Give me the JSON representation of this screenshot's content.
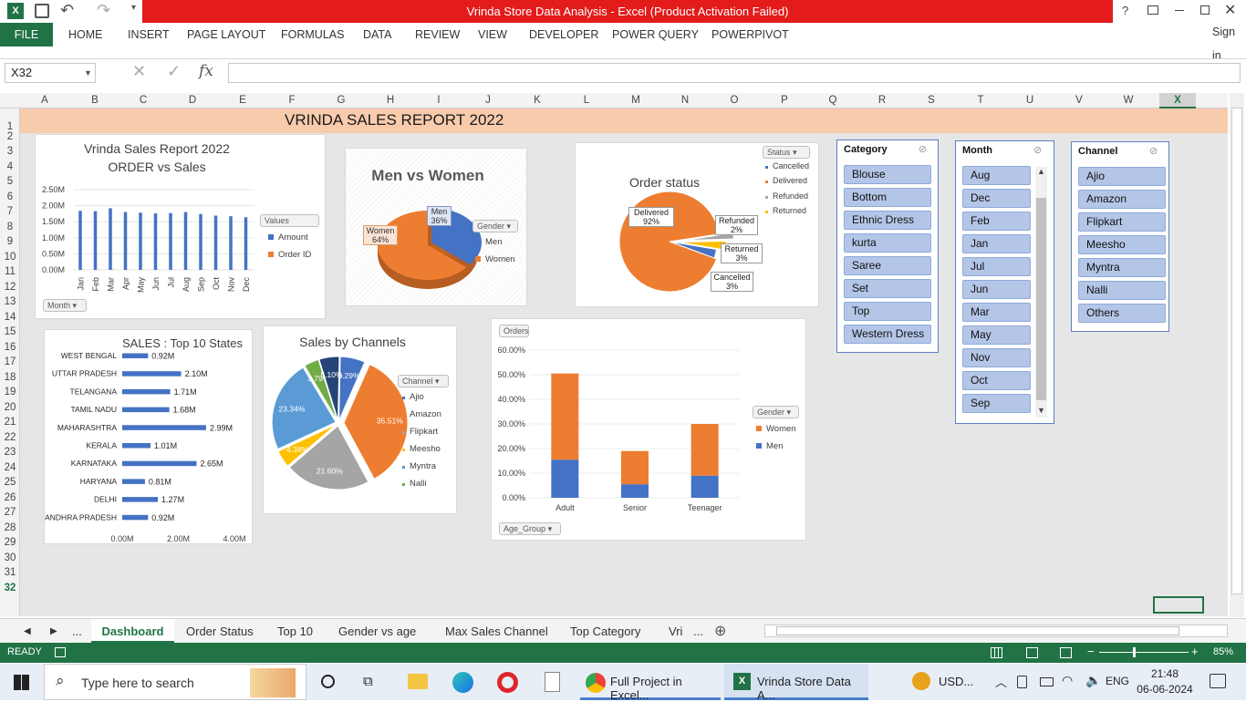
{
  "window": {
    "title": "Vrinda Store Data Analysis -  Excel (Product Activation Failed)",
    "help": "?",
    "signin": "Sign in"
  },
  "ribbon": {
    "file": "FILE",
    "tabs": [
      "HOME",
      "INSERT",
      "PAGE LAYOUT",
      "FORMULAS",
      "DATA",
      "REVIEW",
      "VIEW",
      "DEVELOPER",
      "POWER QUERY",
      "POWERPIVOT"
    ]
  },
  "formula_bar": {
    "name_box": "X32",
    "formula": ""
  },
  "columns": [
    "A",
    "B",
    "C",
    "D",
    "E",
    "F",
    "G",
    "H",
    "I",
    "J",
    "K",
    "L",
    "M",
    "N",
    "O",
    "P",
    "Q",
    "R",
    "S",
    "T",
    "U",
    "V",
    "W",
    "X"
  ],
  "rows": [
    "1",
    "2",
    "3",
    "4",
    "5",
    "6",
    "7",
    "8",
    "9",
    "10",
    "11",
    "12",
    "13",
    "14",
    "15",
    "16",
    "17",
    "18",
    "19",
    "20",
    "21",
    "22",
    "23",
    "24",
    "25",
    "26",
    "27",
    "28",
    "29",
    "30",
    "31",
    "32"
  ],
  "banner": "VRINDA SALES REPORT 2022",
  "chart_orders_sales": {
    "chart_data": {
      "type": "bar",
      "title": "Vrinda Sales Report 2022\nORDER vs Sales",
      "categories": [
        "Jan",
        "Feb",
        "Mar",
        "Apr",
        "May",
        "Jun",
        "Jul",
        "Aug",
        "Sep",
        "Oct",
        "Nov",
        "Dec"
      ],
      "series": [
        {
          "name": "Amount",
          "values": [
            1.84,
            1.83,
            1.92,
            1.8,
            1.78,
            1.76,
            1.77,
            1.8,
            1.74,
            1.69,
            1.67,
            1.64
          ]
        },
        {
          "name": "Order ID",
          "values": [
            0.0027,
            0.0026,
            0.0028,
            0.0026,
            0.0026,
            0.0025,
            0.0025,
            0.0026,
            0.0025,
            0.0024,
            0.0024,
            0.0023
          ]
        }
      ],
      "ylim": [
        0,
        2.5
      ],
      "yticks": [
        "2.50M",
        "2.00M",
        "1.50M",
        "1.00M",
        "0.50M",
        "0.00M"
      ]
    },
    "title1": "Vrinda Sales Report 2022",
    "title2": "ORDER vs Sales",
    "values_chip": "Values",
    "month_chip": "Month"
  },
  "chart_gender": {
    "chart_data": {
      "type": "pie",
      "title": "Men vs Women",
      "labels": [
        "Men",
        "Women"
      ],
      "values": [
        36,
        64
      ]
    },
    "title": "Men vs Women",
    "chip": "Gender",
    "men_label": "Men\n36%",
    "women_label": "Women\n64%"
  },
  "chart_status": {
    "chart_data": {
      "type": "pie",
      "title": "Order status",
      "labels": [
        "Cancelled",
        "Delivered",
        "Refunded",
        "Returned"
      ],
      "values": [
        3,
        92,
        2,
        3
      ]
    },
    "title": "Order status",
    "chip": "Status",
    "lbl_delivered": "Delivered\n92%",
    "lbl_refunded": "Refunded\n2%",
    "lbl_returned": "Returned\n3%",
    "lbl_cancelled": "Cancelled\n3%"
  },
  "chart_states": {
    "chart_data": {
      "type": "bar",
      "title": "SALES : Top 10 States",
      "categories": [
        "WEST BENGAL",
        "UTTAR PRADESH",
        "TELANGANA",
        "TAMIL NADU",
        "MAHARASHTRA",
        "KERALA",
        "KARNATAKA",
        "HARYANA",
        "DELHI",
        "ANDHRA PRADESH"
      ],
      "values": [
        0.92,
        2.1,
        1.71,
        1.68,
        2.99,
        1.01,
        2.65,
        0.81,
        1.27,
        0.92
      ],
      "labels": [
        "0.92M",
        "2.10M",
        "1.71M",
        "1.68M",
        "2.99M",
        "1.01M",
        "2.65M",
        "0.81M",
        "1.27M",
        "0.92M"
      ],
      "xlim": [
        0,
        4
      ],
      "xticks": [
        "0.00M",
        "2.00M",
        "4.00M"
      ]
    },
    "title": "SALES : Top 10 States"
  },
  "chart_channels": {
    "chart_data": {
      "type": "pie",
      "title": "Sales by Channels",
      "labels": [
        "Ajio",
        "Amazon",
        "Flipkart",
        "Meesho",
        "Myntra",
        "Nalli",
        "Others"
      ],
      "values": [
        6.29,
        35.51,
        21.6,
        4.38,
        23.34,
        3.79,
        5.1
      ],
      "display": [
        "6.29%",
        "35.51%",
        "21.60%",
        "4.38%",
        "23.34%",
        "3.79%",
        "5.10%"
      ]
    },
    "title": "Sales by Channels",
    "chip": "Channel"
  },
  "chart_age": {
    "chart_data": {
      "type": "bar",
      "categories": [
        "Adult",
        "Senior",
        "Teenager"
      ],
      "series": [
        {
          "name": "Men",
          "values": [
            15.5,
            5.5,
            9
          ]
        },
        {
          "name": "Women",
          "values": [
            35,
            13.5,
            21
          ]
        }
      ],
      "ylim": [
        0,
        60
      ],
      "yticks": [
        "60.00%",
        "50.00%",
        "40.00%",
        "30.00%",
        "20.00%",
        "10.00%",
        "0.00%"
      ]
    },
    "orders_chip": "Orders",
    "gender_chip": "Gender",
    "age_chip": "Age_Group"
  },
  "colors": {
    "blue": "#4472c4",
    "orange": "#ed7d31",
    "gray": "#a5a5a5",
    "yellow": "#ffc000",
    "lightblue": "#5b9bd5",
    "green": "#70ad47",
    "navy": "#264478",
    "excel_green": "#217346"
  },
  "slicers": {
    "category": {
      "title": "Category",
      "items": [
        "Blouse",
        "Bottom",
        "Ethnic Dress",
        "kurta",
        "Saree",
        "Set",
        "Top",
        "Western Dress"
      ]
    },
    "month": {
      "title": "Month",
      "items": [
        "Aug",
        "Dec",
        "Feb",
        "Jan",
        "Jul",
        "Jun",
        "Mar",
        "May",
        "Nov",
        "Oct",
        "Sep"
      ]
    },
    "channel": {
      "title": "Channel",
      "items": [
        "Ajio",
        "Amazon",
        "Flipkart",
        "Meesho",
        "Myntra",
        "Nalli",
        "Others"
      ]
    }
  },
  "sheet_tabs": [
    "Dashboard",
    "Order Status",
    "Top 10",
    "Gender vs age",
    "Max Sales Channel",
    "Top Category",
    "Vri"
  ],
  "status": {
    "ready": "READY",
    "zoom": "85%"
  },
  "taskbar": {
    "search": "Type here to search",
    "app1": "Full Project in Excel...",
    "app2": "Vrinda Store Data A...",
    "usd": "USD...",
    "lang": "ENG",
    "time": "21:48",
    "date": "06-06-2024"
  }
}
